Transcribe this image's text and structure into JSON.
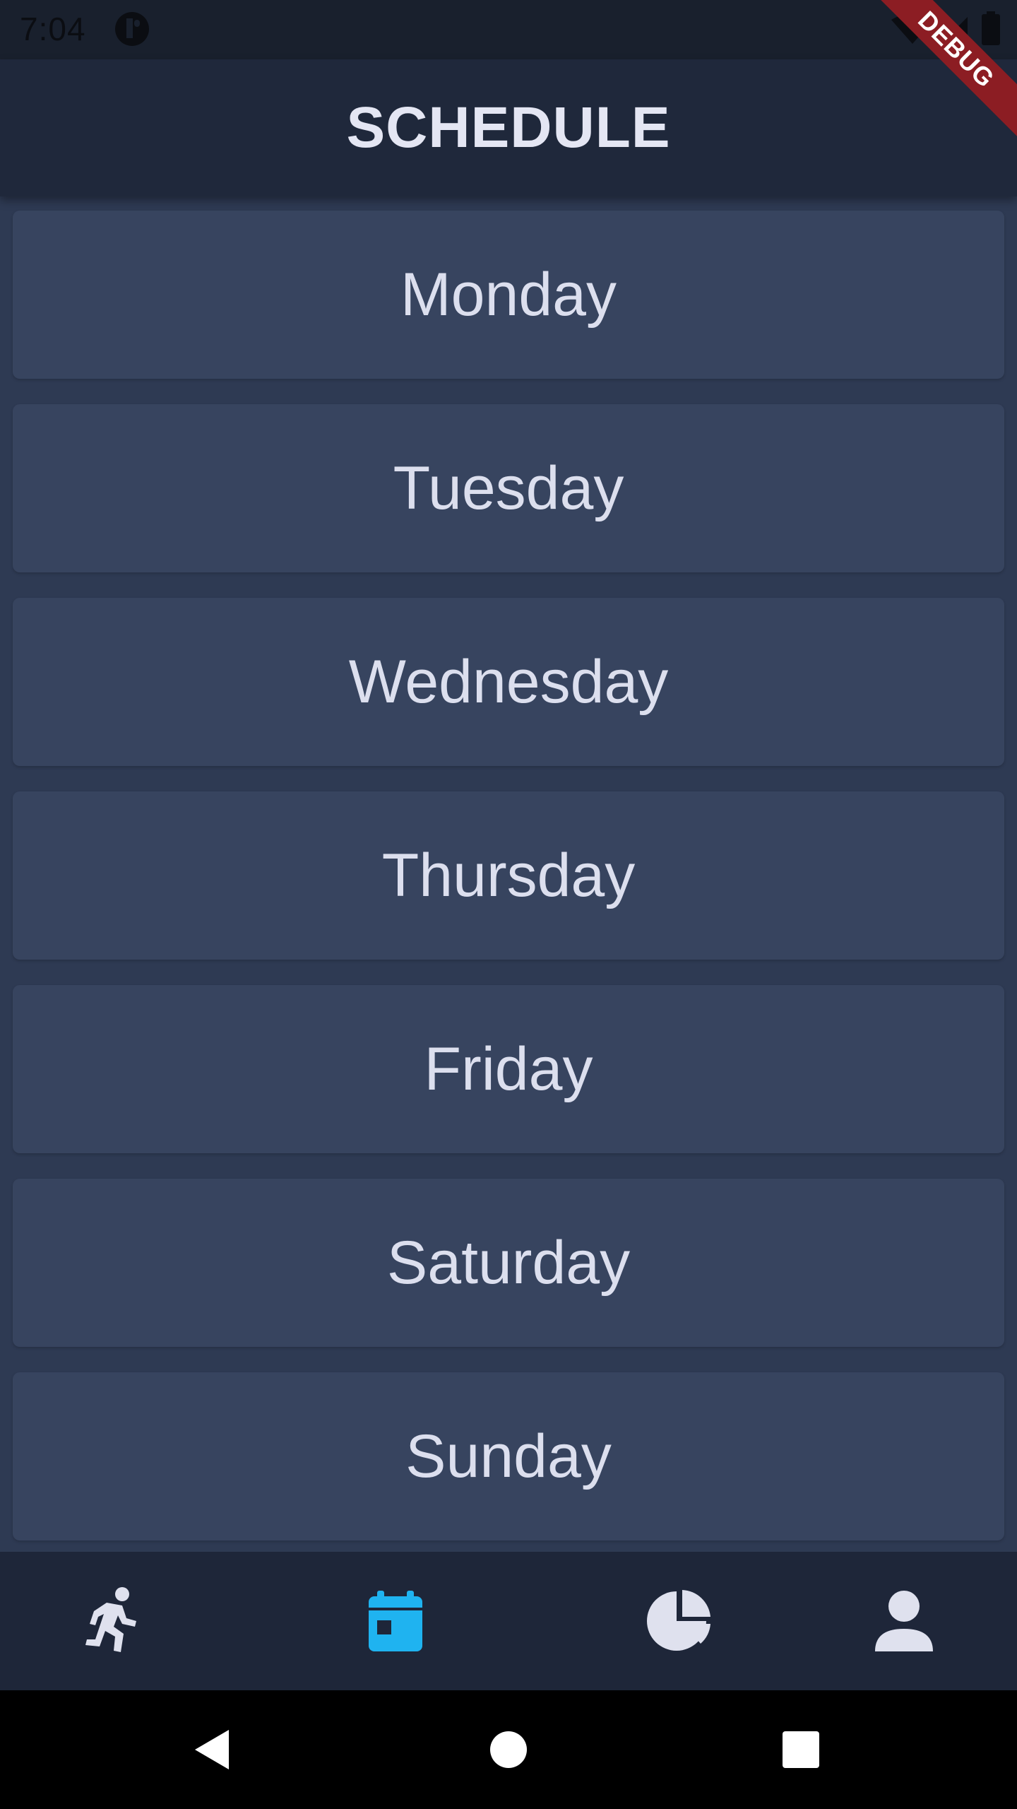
{
  "status_bar": {
    "time": "7:04",
    "icons": [
      "app-notification-icon",
      "wifi-icon",
      "cellular-signal-icon",
      "battery-icon"
    ]
  },
  "debug_banner": {
    "label": "DEBUG",
    "color": "#8c1d23"
  },
  "app_bar": {
    "title": "SCHEDULE"
  },
  "days": [
    {
      "label": "Monday"
    },
    {
      "label": "Tuesday"
    },
    {
      "label": "Wednesday"
    },
    {
      "label": "Thursday"
    },
    {
      "label": "Friday"
    },
    {
      "label": "Saturday"
    },
    {
      "label": "Sunday"
    }
  ],
  "bottom_nav": {
    "items": [
      {
        "icon": "running-icon",
        "selected": false
      },
      {
        "icon": "calendar-icon",
        "selected": true
      },
      {
        "icon": "pie-chart-icon",
        "selected": false
      },
      {
        "icon": "person-icon",
        "selected": false
      }
    ],
    "selected_color": "#1fb3f0",
    "unselected_color": "#dfe1ee"
  },
  "system_nav": {
    "buttons": [
      "back-icon",
      "home-icon",
      "recents-icon"
    ]
  },
  "colors": {
    "background": "#2e3a53",
    "card": "#37445f",
    "app_bar": "#1f283b",
    "text": "#dcdfee"
  }
}
